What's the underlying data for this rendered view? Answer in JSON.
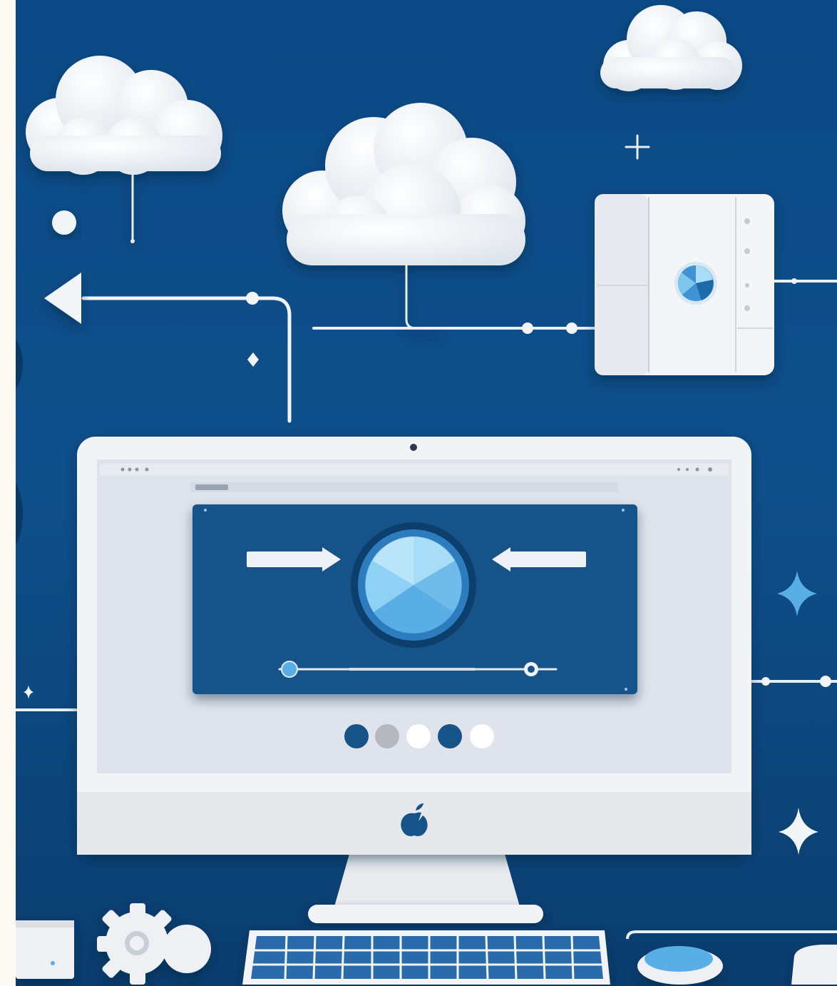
{
  "scene": {
    "subject": "cloud-computing-illustration",
    "colors": {
      "background": "#0f4f8a",
      "background_dark": "#0a3d6e",
      "white": "#ffffff",
      "off_white": "#eef0f3",
      "screen": "#dfe4ec",
      "window_blue": "#155389",
      "accent_light_blue": "#5aaee6",
      "accent_pale_blue": "#a9dcf7",
      "gray": "#b5b8bd"
    },
    "icons": [
      "cloud-icon",
      "server-box-icon",
      "arrow-left-icon",
      "sparkle-icon",
      "plus-icon",
      "apple-logo-icon",
      "gear-icon",
      "mouse-icon",
      "keyboard-icon"
    ],
    "screen_dots": [
      "#155389",
      "#b5b8bd",
      "#ffffff",
      "#155389",
      "#ffffff"
    ]
  }
}
